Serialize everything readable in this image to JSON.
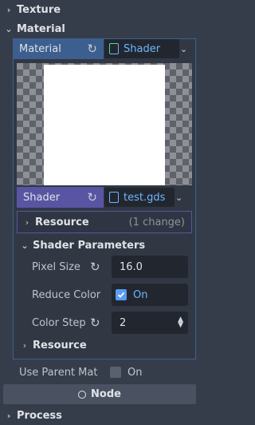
{
  "sections": {
    "texture": "Texture",
    "material": "Material",
    "process": "Process"
  },
  "material_row": {
    "label": "Material",
    "type": "Shader"
  },
  "shader_row": {
    "label": "Shader",
    "file": "test.gds"
  },
  "resource_collapsed": {
    "label": "Resource",
    "changes": "(1 change)"
  },
  "shader_parameters": {
    "title": "Shader Parameters",
    "params": [
      {
        "label": "Pixel Size",
        "value": "16.0"
      },
      {
        "label": "Reduce Color",
        "value": "On",
        "checked": true
      },
      {
        "label": "Color Step",
        "value": "2"
      }
    ]
  },
  "resource_bottom": {
    "label": "Resource"
  },
  "use_parent": {
    "label": "Use Parent Mat",
    "value": "On",
    "checked": false
  },
  "node_section": {
    "label": "Node"
  },
  "colors": {
    "accent_blue": "#6fb4ff",
    "material_header": "#3c5f8f",
    "shader_header": "#5a55a3",
    "background": "#363d4a"
  },
  "icons": [
    "chevron-down-icon",
    "chevron-right-icon",
    "reset-icon",
    "shader-file-icon",
    "dropdown-arrow-icon",
    "checkbox-checked-icon",
    "spin-arrows-icon",
    "circle-icon"
  ]
}
